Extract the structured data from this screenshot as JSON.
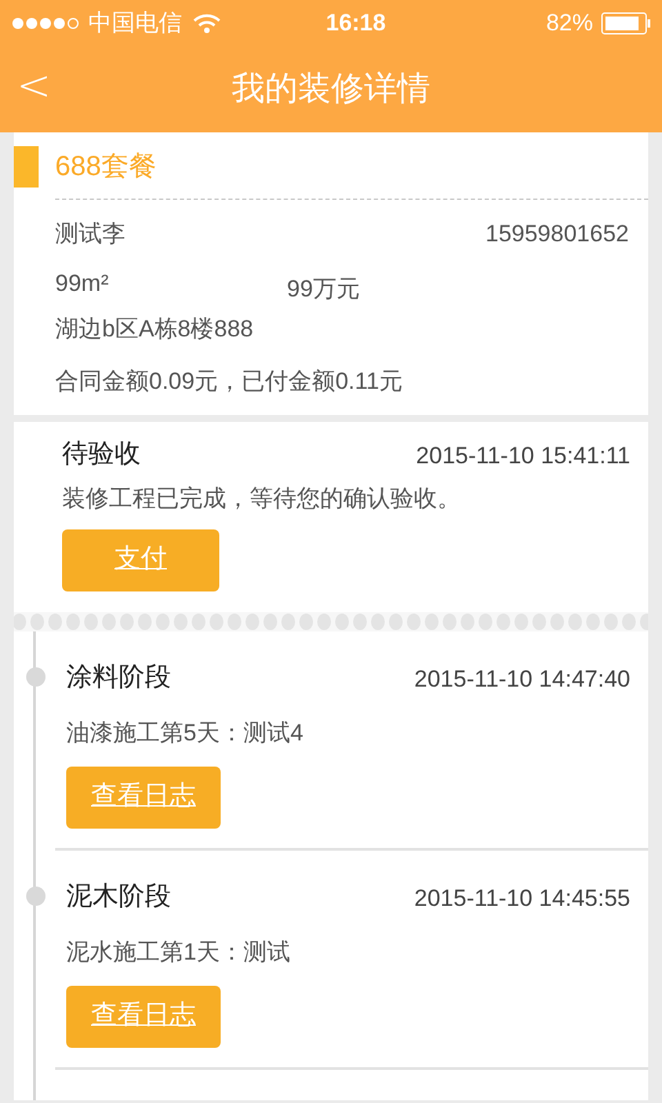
{
  "status_bar": {
    "carrier": "中国电信",
    "time": "16:18",
    "battery": "82%"
  },
  "nav": {
    "back": "<",
    "title": "我的装修详情"
  },
  "package": {
    "title": "688套餐",
    "customer": "测试李",
    "phone": "15959801652",
    "area": "99m²",
    "budget": "99万元",
    "address": "湖边b区A栋8楼888",
    "amounts": "合同金额0.09元，已付金额0.11元"
  },
  "pending": {
    "title": "待验收",
    "time": "2015-11-10 15:41:11",
    "description": "装修工程已完成，等待您的确认验收。",
    "button": "支付"
  },
  "stages": [
    {
      "title": "涂料阶段",
      "time": "2015-11-10 14:47:40",
      "description": "油漆施工第5天：测试4",
      "button": "查看日志"
    },
    {
      "title": "泥木阶段",
      "time": "2015-11-10 14:45:55",
      "description": "泥水施工第1天：测试",
      "button": "查看日志"
    }
  ]
}
